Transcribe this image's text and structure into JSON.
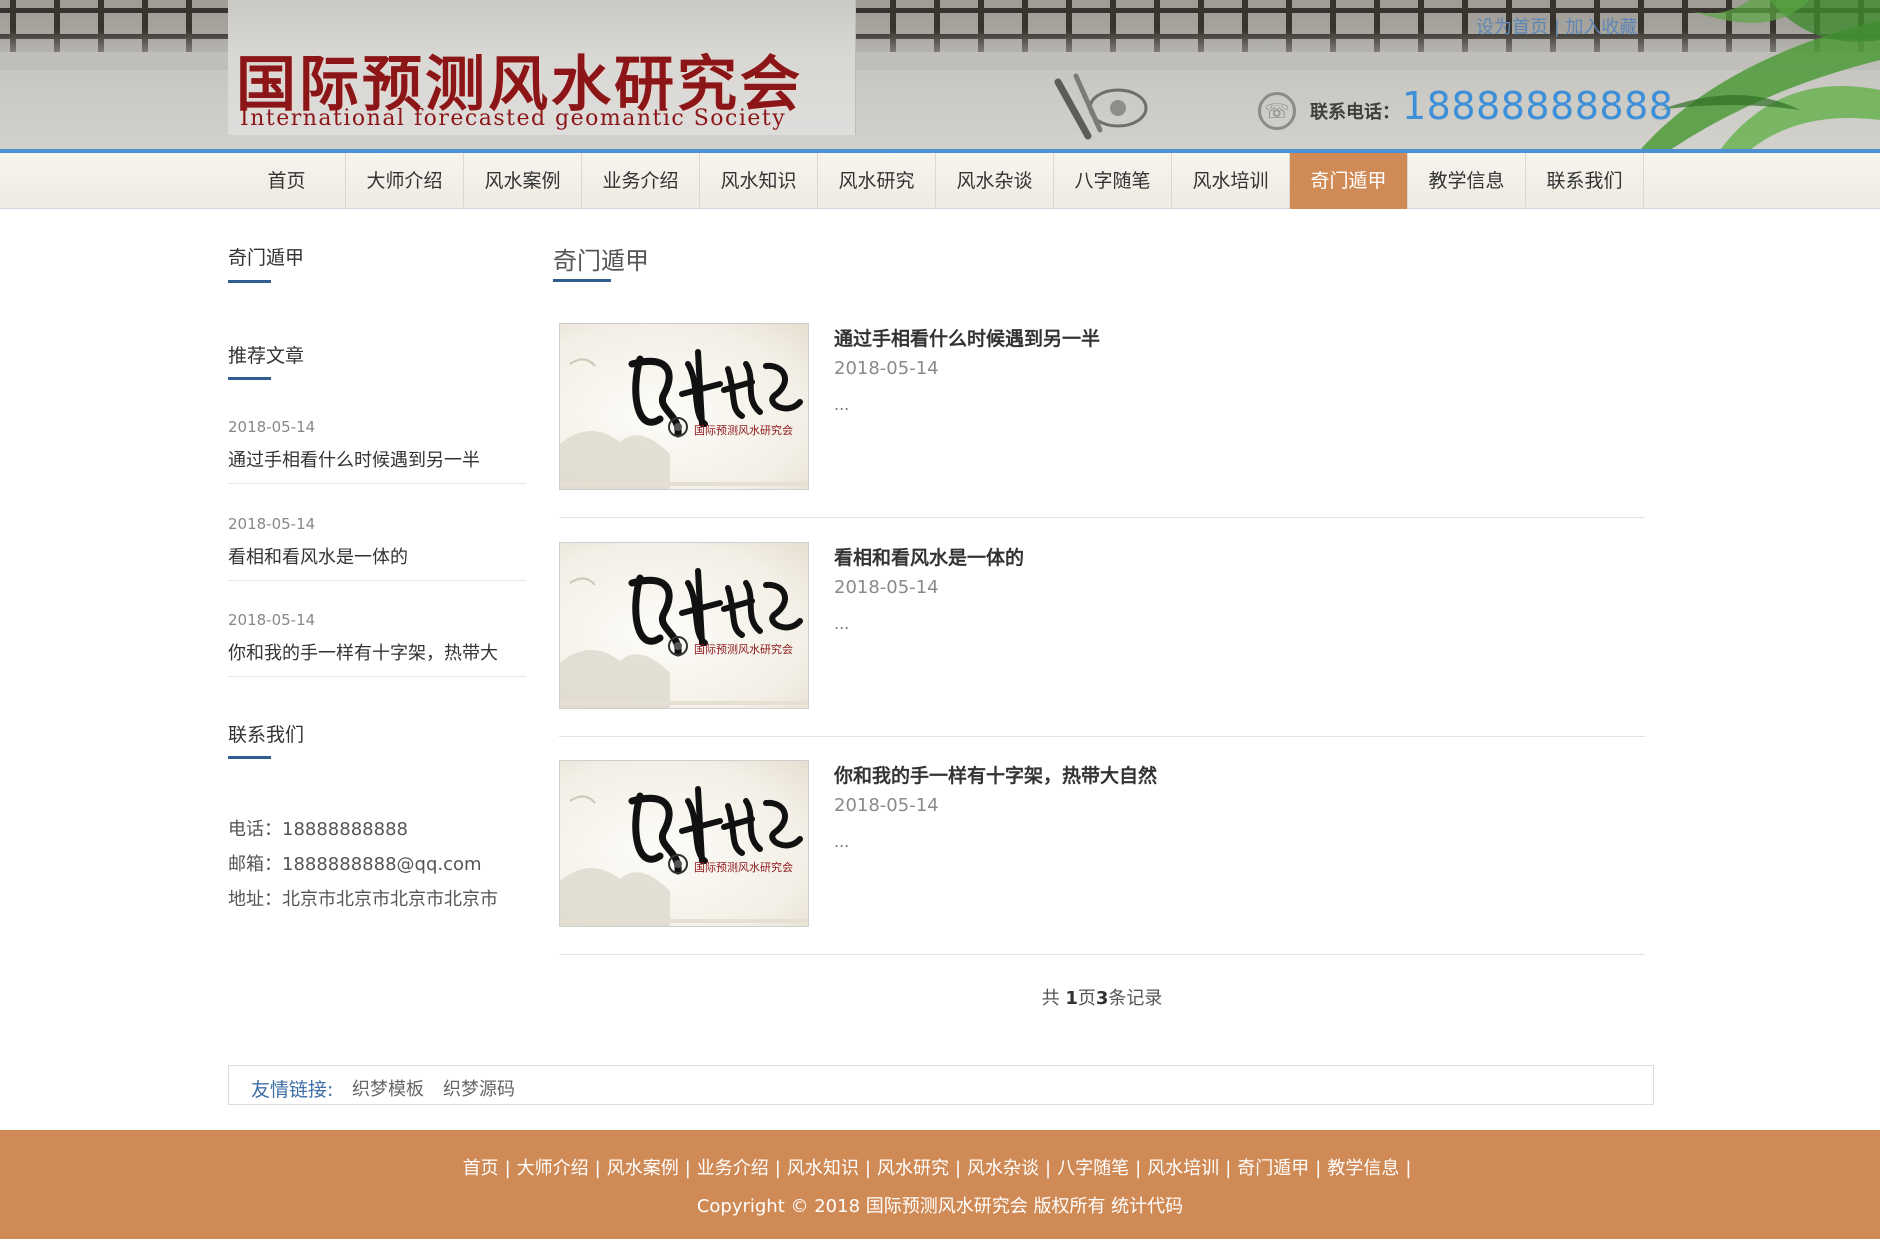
{
  "header": {
    "logo_title": "国际预测风水研究会",
    "logo_subtitle": "International forecasted geomantic Society",
    "top_links": "设为首页 | 加入收藏",
    "phone_label": "联系电话：",
    "phone_number": "18888888888"
  },
  "nav": {
    "items": [
      {
        "label": "首页"
      },
      {
        "label": "大师介绍"
      },
      {
        "label": "风水案例"
      },
      {
        "label": "业务介绍"
      },
      {
        "label": "风水知识"
      },
      {
        "label": "风水研究"
      },
      {
        "label": "风水杂谈"
      },
      {
        "label": "八字随笔"
      },
      {
        "label": "风水培训"
      },
      {
        "label": "奇门遁甲",
        "active": true
      },
      {
        "label": "教学信息"
      },
      {
        "label": "联系我们"
      }
    ]
  },
  "sidebar": {
    "category_title": "奇门遁甲",
    "recommended_title": "推荐文章",
    "recommended": [
      {
        "date": "2018-05-14",
        "title": "通过手相看什么时候遇到另一半"
      },
      {
        "date": "2018-05-14",
        "title": "看相和看风水是一体的"
      },
      {
        "date": "2018-05-14",
        "title": "你和我的手一样有十字架，热带大"
      }
    ],
    "contact_title": "联系我们",
    "contact": {
      "phone": "电话：18888888888",
      "email": "邮箱：1888888888@qq.com",
      "address": "地址：北京市北京市北京市北京市"
    }
  },
  "main": {
    "title": "奇门遁甲",
    "thumb_caption": "国际预测风水研究会",
    "articles": [
      {
        "title": "通过手相看什么时候遇到另一半",
        "date": "2018-05-14",
        "excerpt": "..."
      },
      {
        "title": "看相和看风水是一体的",
        "date": "2018-05-14",
        "excerpt": "..."
      },
      {
        "title": "你和我的手一样有十字架，热带大自然",
        "date": "2018-05-14",
        "excerpt": "..."
      }
    ],
    "pager": {
      "prefix": "共 ",
      "pages": "1",
      "mid": "页",
      "records": "3",
      "suffix": "条记录"
    }
  },
  "friend_links": {
    "label": "友情链接:",
    "links": [
      "织梦模板",
      "织梦源码"
    ]
  },
  "footer": {
    "nav": [
      "首页",
      "大师介绍",
      "风水案例",
      "业务介绍",
      "风水知识",
      "风水研究",
      "风水杂谈",
      "八字随笔",
      "风水培训",
      "奇门遁甲",
      "教学信息"
    ],
    "separator": "|",
    "copyright": "Copyright © 2018 国际预测风水研究会 版权所有  统计代码"
  },
  "colors": {
    "accent": "#d08a55",
    "nav_border": "#4a90d2",
    "logo_red": "#8c1518",
    "phone_blue": "#3d8fd8",
    "title_underline": "#2f5d8e"
  },
  "icons": {
    "phone": "phone-icon",
    "ink_brush": "ink-brush-decoration",
    "bamboo_leaves": "bamboo-leaves-decoration"
  }
}
